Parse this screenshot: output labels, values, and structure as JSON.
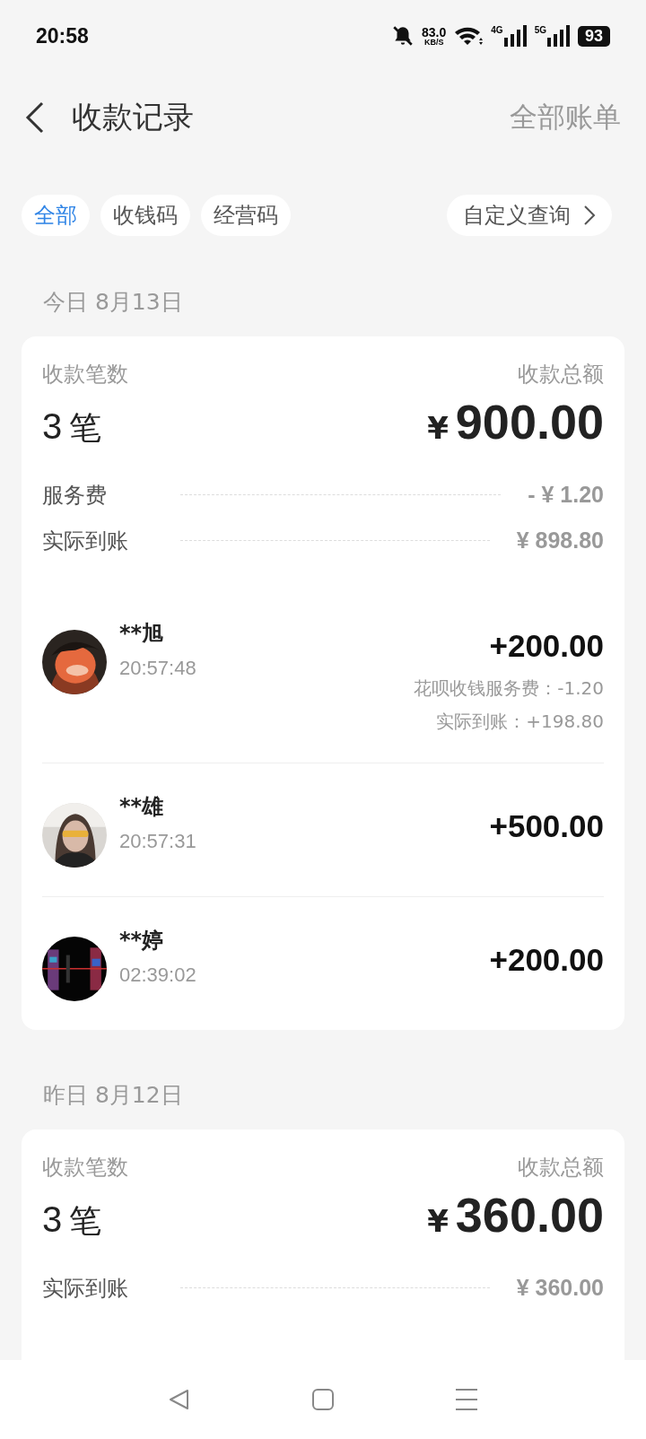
{
  "status_bar": {
    "time": "20:58",
    "net_speed": "83.0",
    "net_unit": "KB/S",
    "networks": [
      "4G",
      "5G"
    ],
    "battery": "93"
  },
  "header": {
    "title": "收款记录",
    "action": "全部账单"
  },
  "filters": [
    {
      "label": "全部",
      "selected": true
    },
    {
      "label": "收钱码",
      "selected": false
    },
    {
      "label": "经营码",
      "selected": false
    }
  ],
  "custom_query": "自定义查询",
  "days": [
    {
      "date": "今日 8月13日",
      "count_label": "收款笔数",
      "count": "3",
      "count_unit": "笔",
      "total_label": "收款总额",
      "currency": "¥",
      "total": "900.00",
      "lines": [
        {
          "label": "服务费",
          "value": "- ¥ 1.20"
        },
        {
          "label": "实际到账",
          "value": "¥ 898.80"
        }
      ],
      "transactions": [
        {
          "name": "**旭",
          "time": "20:57:48",
          "amount": "+200.00",
          "details": [
            "花呗收钱服务费：-1.20",
            "实际到账：+198.80"
          ]
        },
        {
          "name": "**雄",
          "time": "20:57:31",
          "amount": "+500.00"
        },
        {
          "name": "**婷",
          "time": "02:39:02",
          "amount": "+200.00"
        }
      ]
    },
    {
      "date": "昨日 8月12日",
      "count_label": "收款笔数",
      "count": "3",
      "count_unit": "笔",
      "total_label": "收款总额",
      "currency": "¥",
      "total": "360.00",
      "lines": [
        {
          "label": "实际到账",
          "value": "¥ 360.00"
        }
      ]
    }
  ]
}
